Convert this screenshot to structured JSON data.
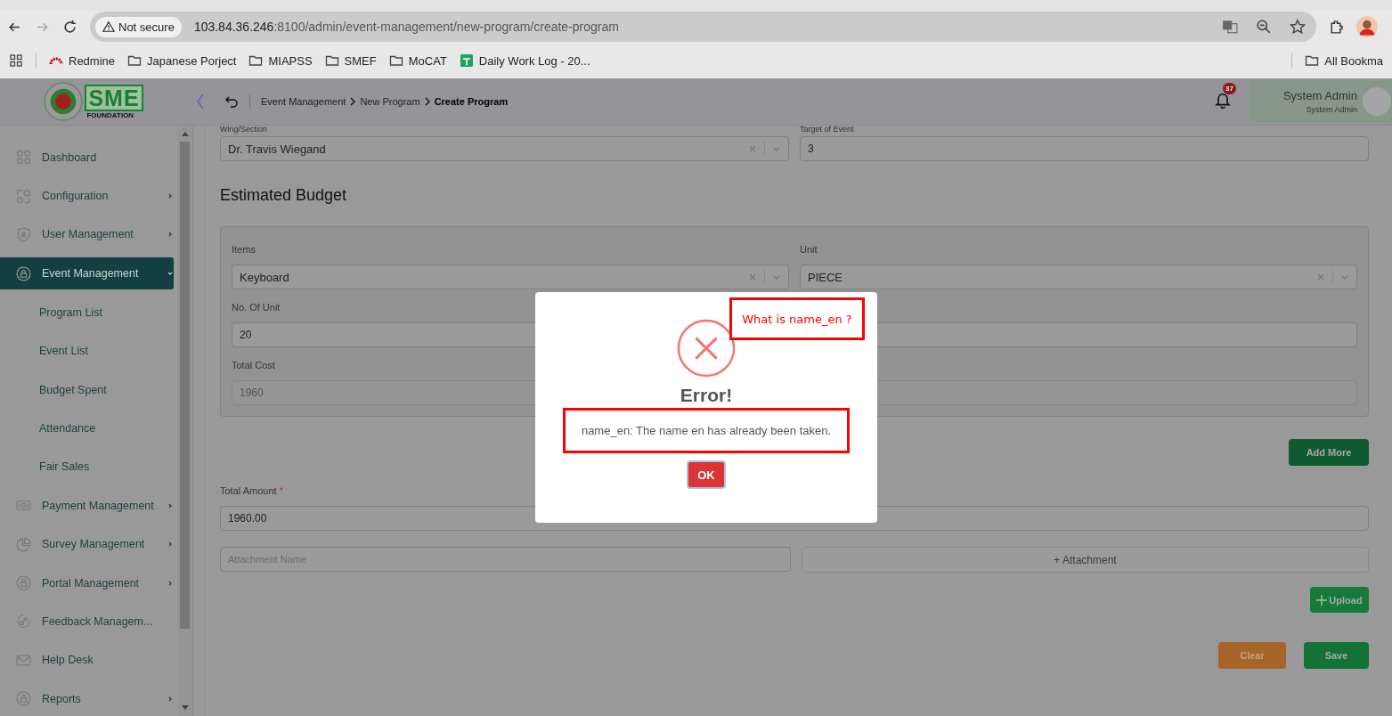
{
  "browser": {
    "security": "Not secure",
    "url_host": "103.84.36.246",
    "url_path": ":8100/admin/event-management/new-program/create-program",
    "bookmarks": [
      {
        "label": "Redmine",
        "kind": "redmine"
      },
      {
        "label": "Japanese Porject",
        "kind": "folder"
      },
      {
        "label": "MIAPSS",
        "kind": "folder"
      },
      {
        "label": "SMEF",
        "kind": "folder"
      },
      {
        "label": "MoCAT",
        "kind": "folder"
      },
      {
        "label": "Daily Work Log - 20...",
        "kind": "sheet"
      }
    ],
    "all_bookmarks": "All Bookma"
  },
  "header": {
    "logo": {
      "letters": "SME",
      "caption": "FOUNDATION"
    },
    "breadcrumb": [
      {
        "label": "Event Management",
        "current": false
      },
      {
        "label": "New Program",
        "current": false
      },
      {
        "label": "Create Program",
        "current": true
      }
    ],
    "notification_count": "37",
    "user": {
      "name": "System Admin",
      "role": "System Admin"
    }
  },
  "sidebar": {
    "items": [
      {
        "label": "Dashboard",
        "kind": "grid",
        "selected": false,
        "has_submenu": false
      },
      {
        "label": "Configuration",
        "kind": "config",
        "selected": false,
        "has_submenu": true
      },
      {
        "label": "User Management",
        "kind": "shield",
        "selected": false,
        "has_submenu": true
      },
      {
        "label": "Event Management",
        "kind": "lock",
        "selected": true,
        "has_submenu": true,
        "expanded": true,
        "children": [
          {
            "label": "Program List"
          },
          {
            "label": "Event List"
          },
          {
            "label": "Budget Spent"
          },
          {
            "label": "Attendance"
          },
          {
            "label": "Fair Sales"
          }
        ]
      },
      {
        "label": "Payment Management",
        "kind": "money",
        "selected": false,
        "has_submenu": true
      },
      {
        "label": "Survey Management",
        "kind": "pie",
        "selected": false,
        "has_submenu": true
      },
      {
        "label": "Portal Management",
        "kind": "lock",
        "selected": false,
        "has_submenu": true
      },
      {
        "label": "Feedback Managem...",
        "kind": "feedback",
        "selected": false,
        "has_submenu": false
      },
      {
        "label": "Help Desk",
        "kind": "mail",
        "selected": false,
        "has_submenu": false
      },
      {
        "label": "Reports",
        "kind": "lock",
        "selected": false,
        "has_submenu": true
      }
    ]
  },
  "form": {
    "wing_section": {
      "label": "Wing/Section",
      "value": "Dr. Travis Wiegand"
    },
    "target_of_event": {
      "label": "Target of Event",
      "value": "3"
    },
    "budget_title": "Estimated Budget",
    "items": {
      "label": "Items",
      "value": "Keyboard"
    },
    "unit": {
      "label": "Unit",
      "value": "PIECE"
    },
    "no_of_unit": {
      "label": "No. Of Unit",
      "value": "20"
    },
    "total_cost": {
      "label": "Total Cost",
      "value": "1960",
      "disabled": true
    },
    "add_more": "Add More",
    "total_amount": {
      "label": "Total Amount",
      "required_mark": "*",
      "value": "1960.00"
    },
    "attachment_name": {
      "placeholder": "Attachment Name"
    },
    "attachment_button": "+ Attachment",
    "upload": "Upload",
    "clear": "Clear",
    "save": "Save"
  },
  "dialog": {
    "title": "Error!",
    "message": "name_en: The name en has already been taken.",
    "ok": "OK",
    "annotation": "What is name_en ?"
  }
}
